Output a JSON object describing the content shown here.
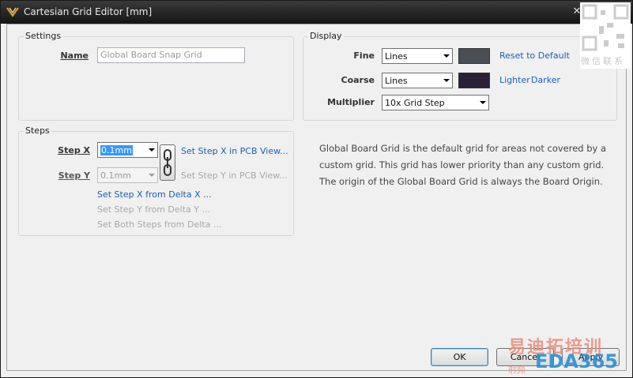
{
  "window": {
    "title": "Cartesian Grid Editor [mm]"
  },
  "settings": {
    "legend": "Settings",
    "name_label": "Name",
    "name_value": "Global Board Snap Grid"
  },
  "display": {
    "legend": "Display",
    "fine_label": "Fine",
    "fine_value": "Lines",
    "fine_color": "#4a4e55",
    "coarse_label": "Coarse",
    "coarse_value": "Lines",
    "coarse_color": "#2a2138",
    "multiplier_label": "Multiplier",
    "multiplier_value": "10x Grid Step",
    "reset_link": "Reset to Default",
    "lighter_link": "Lighter",
    "darker_link": "Darker"
  },
  "steps": {
    "legend": "Steps",
    "step_x_label": "Step X",
    "step_x_value": "0.1mm",
    "step_y_label": "Step Y",
    "step_y_value": "0.1mm",
    "set_x_pcb": "Set Step X in PCB View...",
    "set_y_pcb": "Set Step Y in PCB View...",
    "set_x_delta": "Set Step X from Delta X ...",
    "set_y_delta": "Set Step Y from Delta Y ...",
    "set_both": "Set Both Steps from Delta ..."
  },
  "description": {
    "line1": "Global Board Grid is the default grid for areas not covered by a",
    "line2": "custom grid. This grid has lower priority than any custom grid.",
    "line3": "The origin of the Global Board Grid is always the Board Origin."
  },
  "buttons": {
    "ok": "OK",
    "cancel": "Cancel",
    "apply": "Apply"
  },
  "watermark": {
    "cn_top": "微信联系",
    "logo_cn": "易迪拓培训",
    "logo_en": "EDA365",
    "logo_sub": "射频"
  }
}
